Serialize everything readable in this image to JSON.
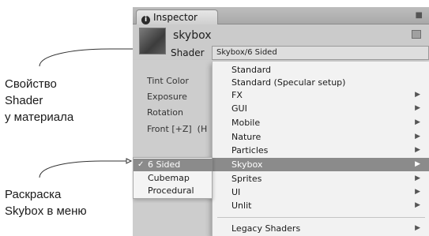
{
  "annotations": {
    "shader_property": [
      "Свойство",
      "Shader",
      "у материала"
    ],
    "skybox_menu": [
      "Раскраска",
      "Skybox в меню"
    ]
  },
  "inspector": {
    "tab_label": "Inspector",
    "material_name": "skybox",
    "shader_label": "Shader",
    "shader_value": "Skybox/6 Sided",
    "properties": [
      "Tint Color",
      "Exposure",
      "Rotation",
      "Front [+Z]",
      "(H"
    ]
  },
  "shader_menu": {
    "items": [
      {
        "label": "Standard",
        "submenu": false
      },
      {
        "label": "Standard (Specular setup)",
        "submenu": false
      },
      {
        "label": "FX",
        "submenu": true
      },
      {
        "label": "GUI",
        "submenu": true
      },
      {
        "label": "Mobile",
        "submenu": true
      },
      {
        "label": "Nature",
        "submenu": true
      },
      {
        "label": "Particles",
        "submenu": true
      },
      {
        "label": "Skybox",
        "submenu": true,
        "highlighted": true
      },
      {
        "label": "Sprites",
        "submenu": true
      },
      {
        "label": "UI",
        "submenu": true
      },
      {
        "label": "Unlit",
        "submenu": true
      },
      {
        "label": "Legacy Shaders",
        "submenu": true
      }
    ],
    "arrow_glyph": "▶"
  },
  "skybox_submenu": {
    "items": [
      {
        "label": "6 Sided",
        "checked": true,
        "highlighted": true
      },
      {
        "label": "Cubemap",
        "checked": false
      },
      {
        "label": "Procedural",
        "checked": false
      }
    ],
    "check_glyph": "✓"
  },
  "colors": {
    "highlight": "#8b8b8b",
    "menu_bg": "#f2f2f2",
    "panel_bg": "#c9c9c9"
  }
}
